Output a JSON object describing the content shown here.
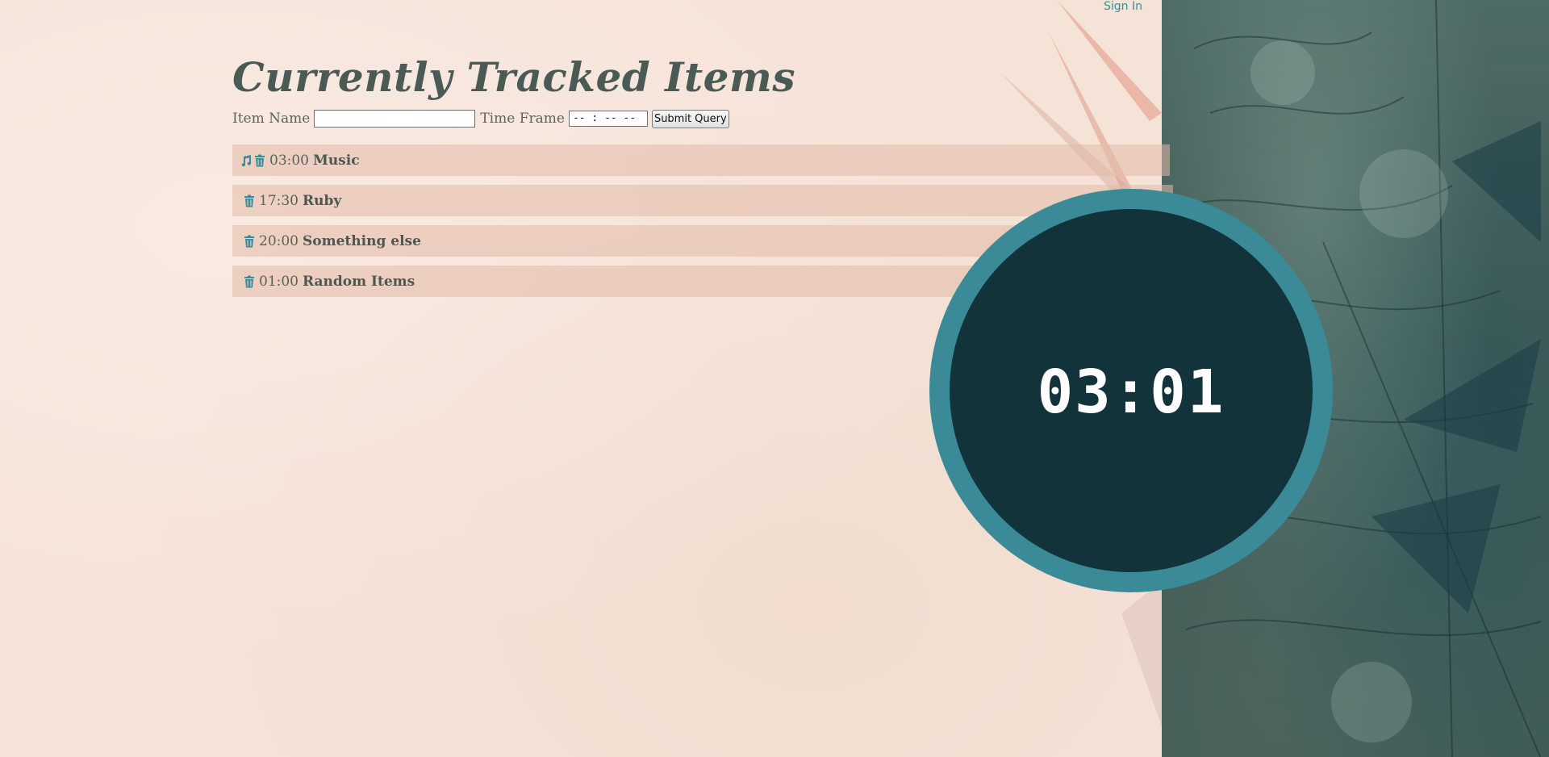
{
  "header": {
    "signin_label": "Sign In"
  },
  "page": {
    "title": "Currently Tracked Items"
  },
  "form": {
    "item_name_label": "Item Name",
    "item_name_value": "",
    "time_frame_label": "Time Frame",
    "time_frame_placeholder": "-- : --  --",
    "submit_label": "Submit Query"
  },
  "items": [
    {
      "time": "03:00",
      "name": "Music",
      "playing": true
    },
    {
      "time": "17:30",
      "name": "Ruby",
      "playing": false
    },
    {
      "time": "20:00",
      "name": "Something else",
      "playing": false
    },
    {
      "time": "01:00",
      "name": "Random Items",
      "playing": false
    }
  ],
  "timer": {
    "display": "03:01"
  },
  "icons": {
    "music": "music-note-icon",
    "delete": "trash-icon"
  },
  "colors": {
    "accent": "#3a8b97",
    "timer_inner": "#12333a",
    "title": "#4a5a55",
    "row_bg": "#ebcdbf",
    "page_bg": "#f6e3d8"
  }
}
